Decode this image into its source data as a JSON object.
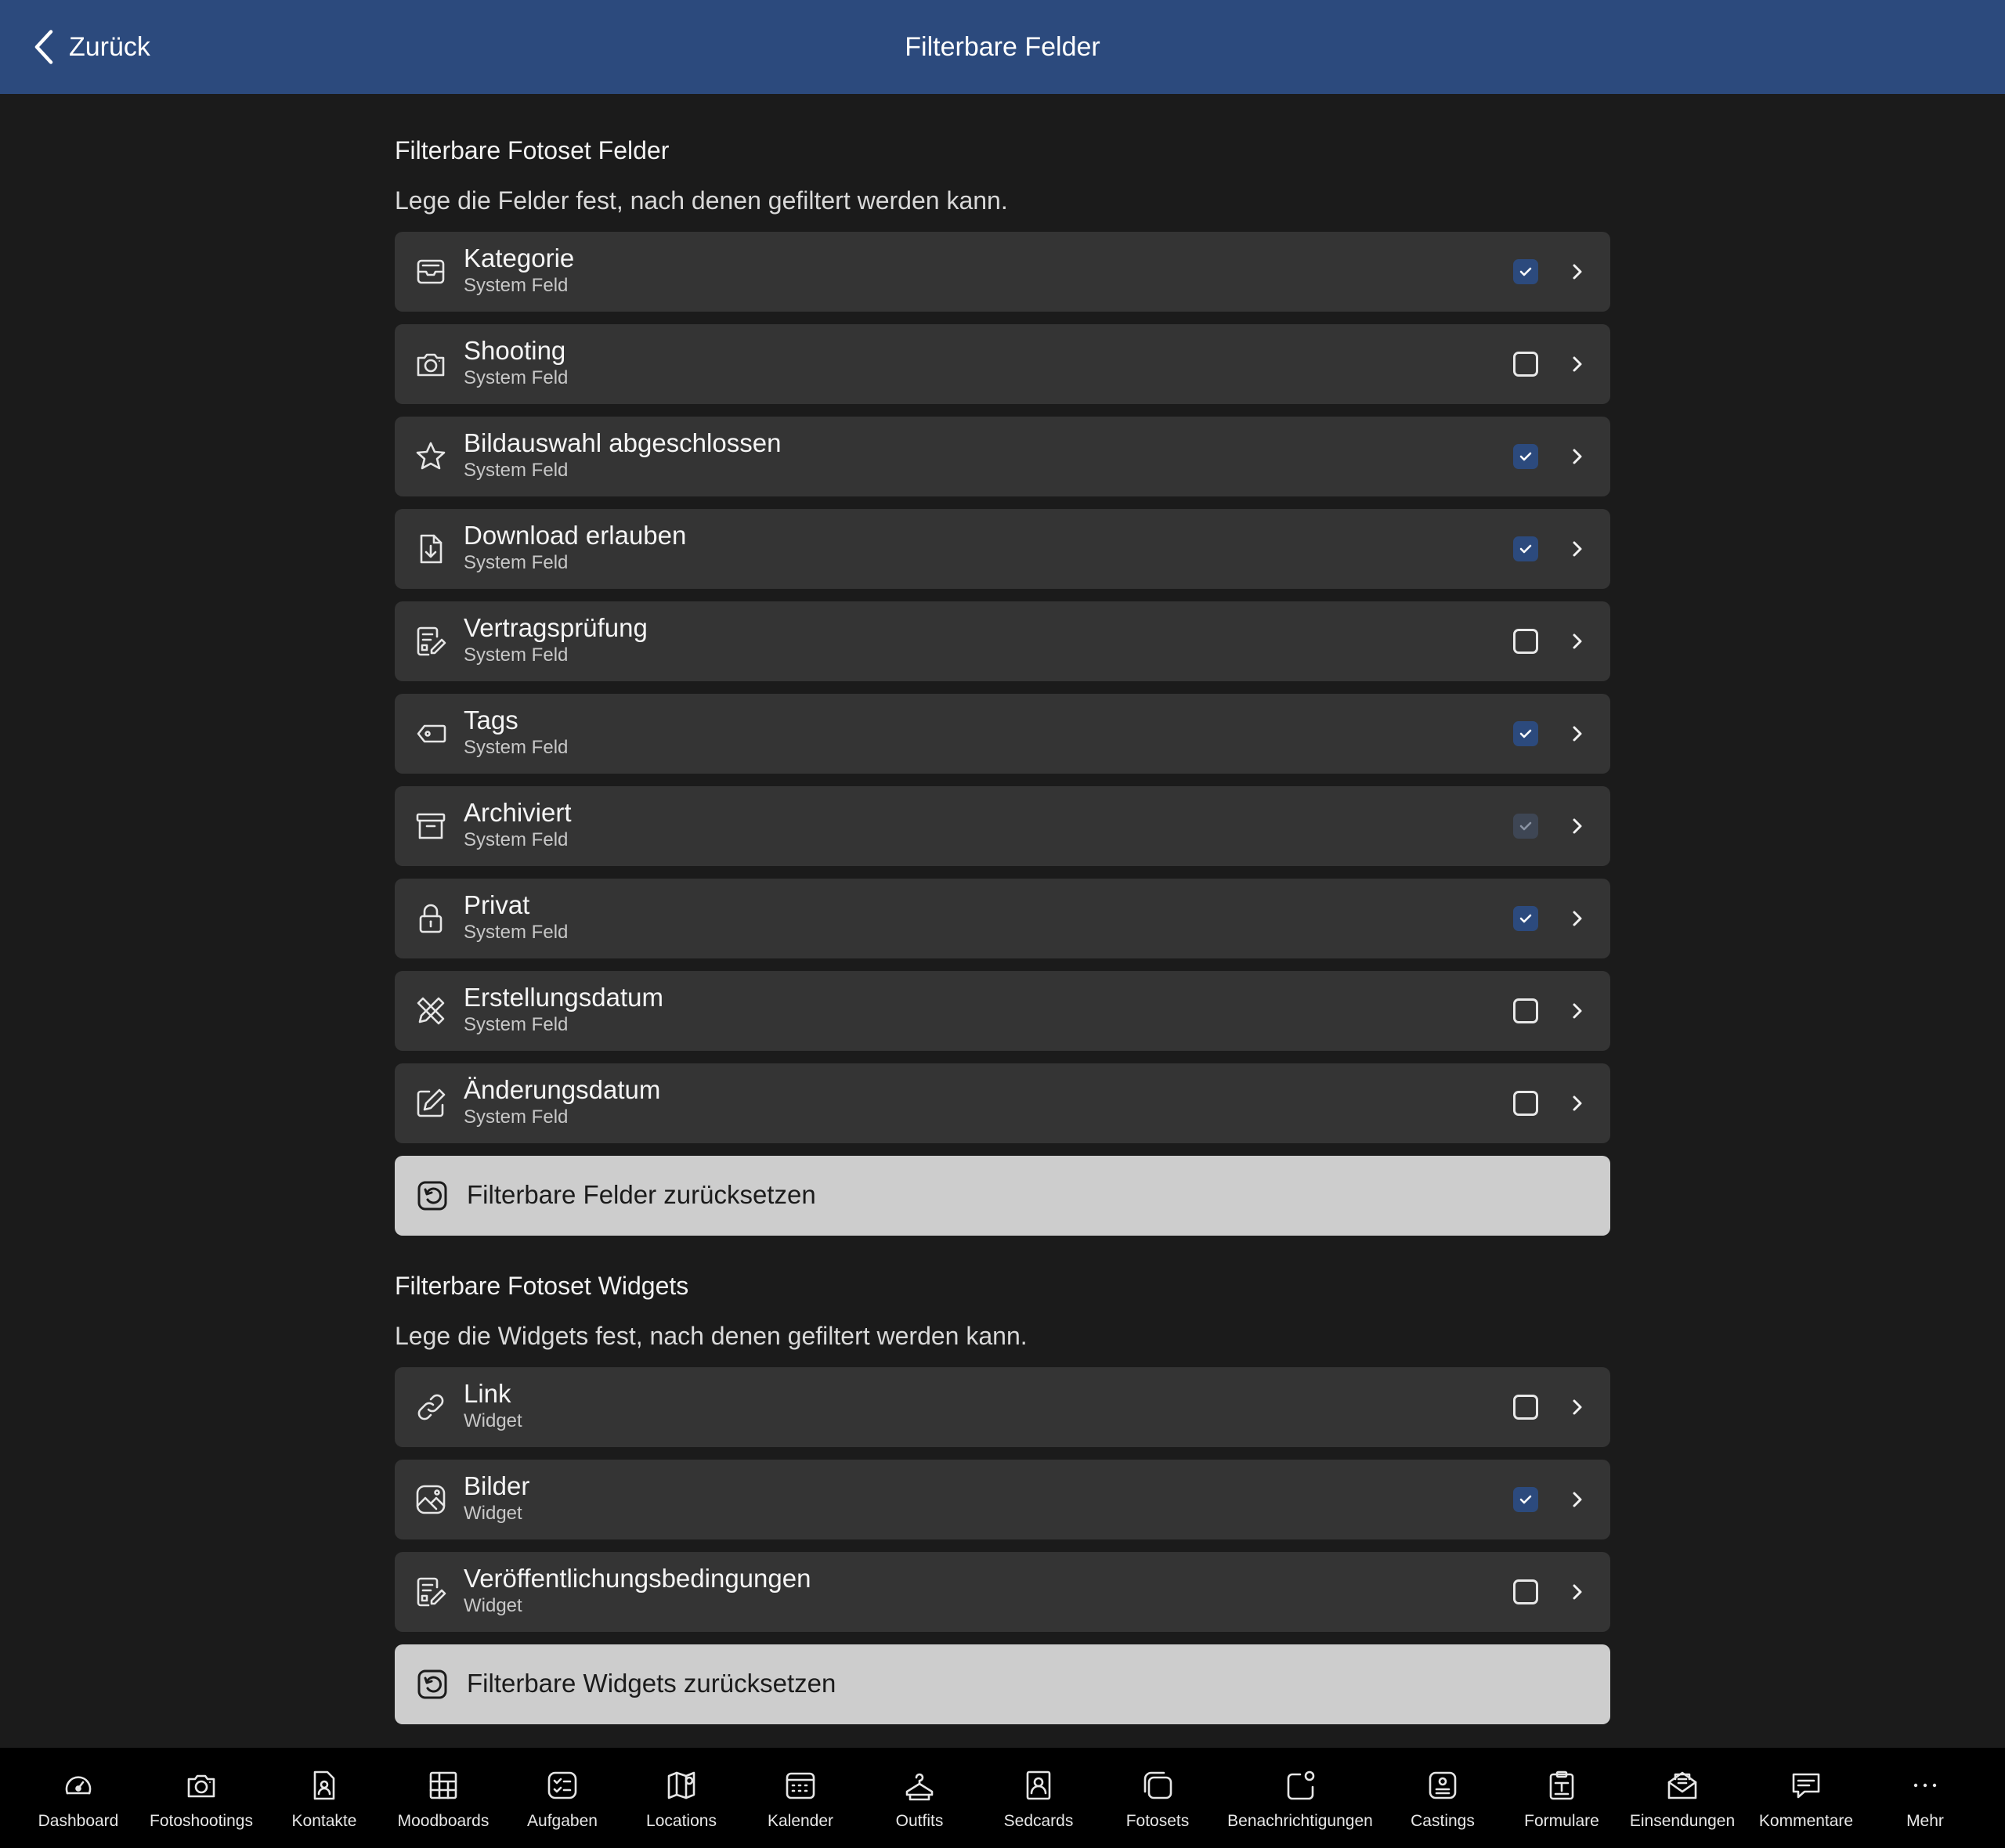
{
  "header": {
    "back_label": "Zurück",
    "title": "Filterbare Felder"
  },
  "fields_section": {
    "title": "Filterbare Fotoset Felder",
    "description": "Lege die Felder fest, nach denen gefiltert werden kann.",
    "items": [
      {
        "label": "Kategorie",
        "sub": "System Feld",
        "icon": "tray-icon",
        "checked": "on"
      },
      {
        "label": "Shooting",
        "sub": "System Feld",
        "icon": "camera-icon",
        "checked": "off"
      },
      {
        "label": "Bildauswahl abgeschlossen",
        "sub": "System Feld",
        "icon": "star-icon",
        "checked": "on"
      },
      {
        "label": "Download erlauben",
        "sub": "System Feld",
        "icon": "file-download-icon",
        "checked": "on"
      },
      {
        "label": "Vertragsprüfung",
        "sub": "System Feld",
        "icon": "document-edit-icon",
        "checked": "off"
      },
      {
        "label": "Tags",
        "sub": "System Feld",
        "icon": "tag-icon",
        "checked": "on"
      },
      {
        "label": "Archiviert",
        "sub": "System Feld",
        "icon": "archive-icon",
        "checked": "dim"
      },
      {
        "label": "Privat",
        "sub": "System Feld",
        "icon": "lock-icon",
        "checked": "on"
      },
      {
        "label": "Erstellungsdatum",
        "sub": "System Feld",
        "icon": "pencil-ruler-icon",
        "checked": "off"
      },
      {
        "label": "Änderungsdatum",
        "sub": "System Feld",
        "icon": "edit-square-icon",
        "checked": "off"
      }
    ],
    "reset_label": "Filterbare Felder zurücksetzen"
  },
  "widgets_section": {
    "title": "Filterbare Fotoset Widgets",
    "description": "Lege die Widgets fest, nach denen gefiltert werden kann.",
    "items": [
      {
        "label": "Link",
        "sub": "Widget",
        "icon": "link-icon",
        "checked": "off"
      },
      {
        "label": "Bilder",
        "sub": "Widget",
        "icon": "image-icon",
        "checked": "on"
      },
      {
        "label": "Veröffentlichungsbedingungen",
        "sub": "Widget",
        "icon": "document-edit-icon",
        "checked": "off"
      }
    ],
    "reset_label": "Filterbare Widgets zurücksetzen"
  },
  "tabbar": [
    {
      "label": "Dashboard",
      "icon": "gauge-icon"
    },
    {
      "label": "Fotoshootings",
      "icon": "camera-icon"
    },
    {
      "label": "Kontakte",
      "icon": "contact-file-icon"
    },
    {
      "label": "Moodboards",
      "icon": "grid-board-icon"
    },
    {
      "label": "Aufgaben",
      "icon": "checklist-icon"
    },
    {
      "label": "Locations",
      "icon": "map-pin-icon"
    },
    {
      "label": "Kalender",
      "icon": "calendar-icon"
    },
    {
      "label": "Outfits",
      "icon": "hanger-icon"
    },
    {
      "label": "Sedcards",
      "icon": "portrait-card-icon"
    },
    {
      "label": "Fotosets",
      "icon": "stacked-squares-icon"
    },
    {
      "label": "Benachrichtigungen",
      "icon": "notification-icon"
    },
    {
      "label": "Castings",
      "icon": "id-card-icon"
    },
    {
      "label": "Formulare",
      "icon": "clipboard-icon"
    },
    {
      "label": "Einsendungen",
      "icon": "envelope-open-icon"
    },
    {
      "label": "Kommentare",
      "icon": "chat-icon"
    },
    {
      "label": "Mehr",
      "icon": "more-icon"
    }
  ]
}
